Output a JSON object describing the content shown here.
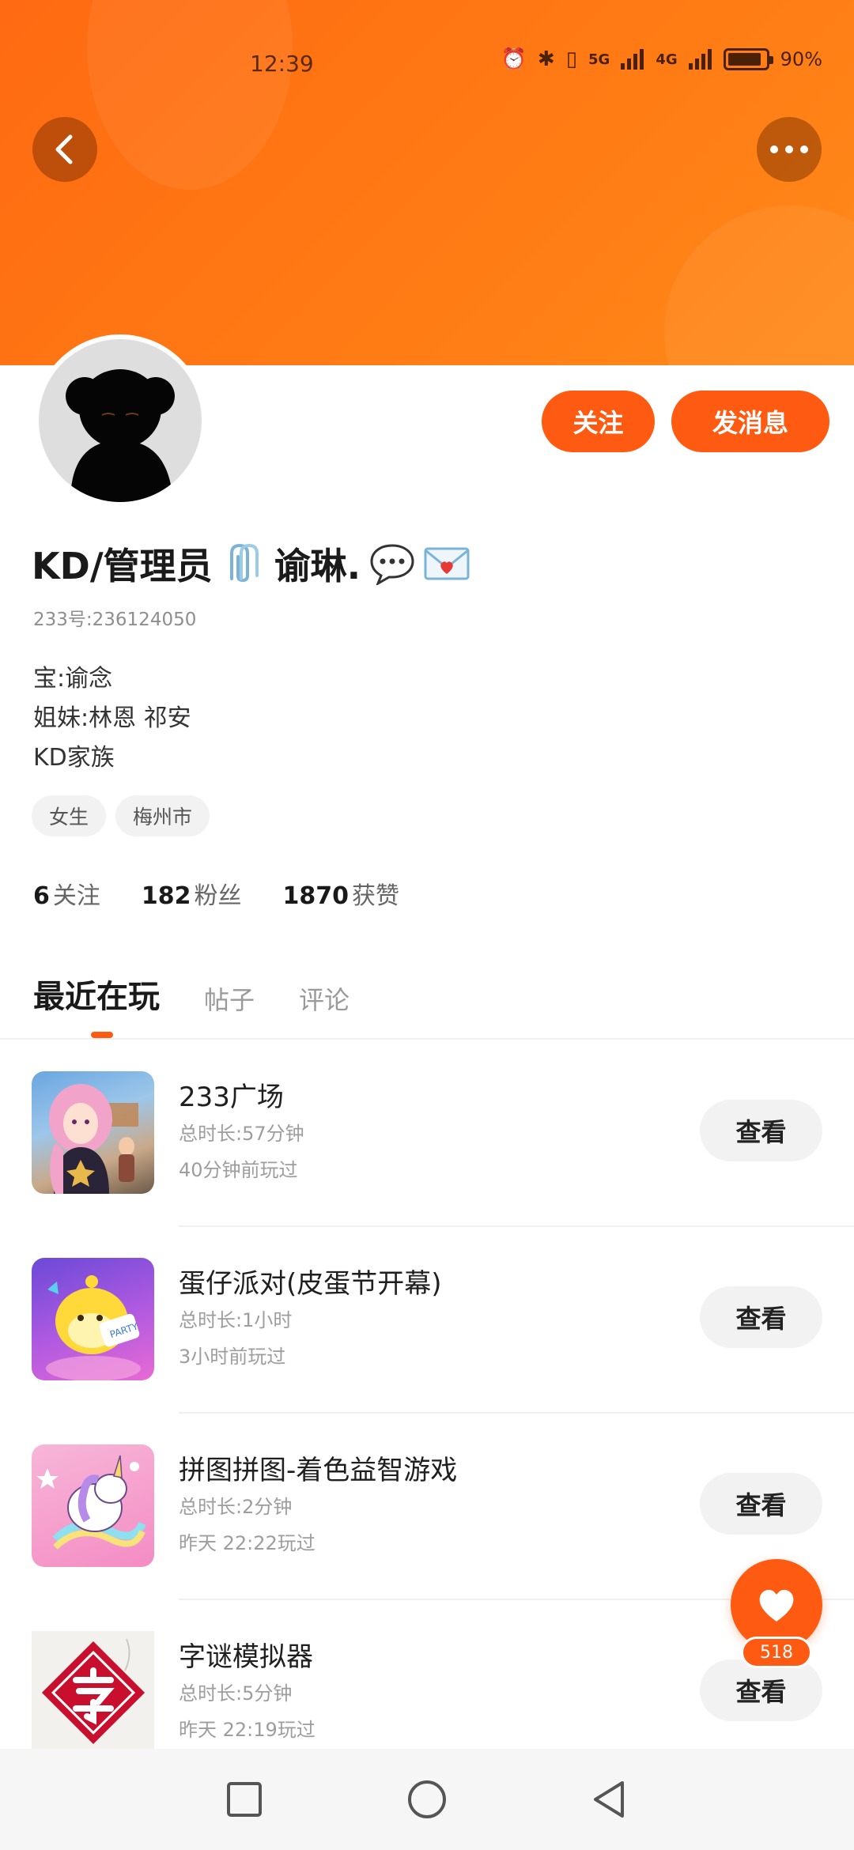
{
  "status_bar": {
    "time": "12:39",
    "network_5g": "5G",
    "network_4g": "4G",
    "battery_percent": "90%",
    "battery_level": 0.9
  },
  "header": {
    "back_icon": "chevron-left-icon",
    "more_icon": "more-horizontal-icon"
  },
  "actions": {
    "follow_label": "关注",
    "message_label": "发消息"
  },
  "profile": {
    "name": "KD/管理员",
    "name_suffix": "谕琳.",
    "uid": "233号:236124050",
    "bio_lines": [
      "宝:谕念",
      "姐妹:林恩 祁安",
      "KD家族"
    ],
    "tags": [
      "女生",
      "梅州市"
    ]
  },
  "stats": {
    "following_count": "6",
    "following_label": "关注",
    "fans_count": "182",
    "fans_label": "粉丝",
    "likes_count": "1870",
    "likes_label": "获赞"
  },
  "tabs": [
    "最近在玩",
    "帖子",
    "评论"
  ],
  "games": [
    {
      "title": "233广场",
      "duration": "总时长:57分钟",
      "last_played": "40分钟前玩过",
      "button": "查看"
    },
    {
      "title": "蛋仔派对(皮蛋节开幕)",
      "duration": "总时长:1小时",
      "last_played": "3小时前玩过",
      "button": "查看"
    },
    {
      "title": "拼图拼图-着色益智游戏",
      "duration": "总时长:2分钟",
      "last_played": "昨天 22:22玩过",
      "button": "查看"
    },
    {
      "title": "字谜模拟器",
      "duration": "总时长:5分钟",
      "last_played": "昨天 22:19玩过",
      "button": "查看"
    }
  ],
  "like_fab": {
    "count": "518",
    "icon": "heart-icon"
  },
  "colors": {
    "accent": "#ff5a12",
    "banner": "#ff7a14"
  }
}
